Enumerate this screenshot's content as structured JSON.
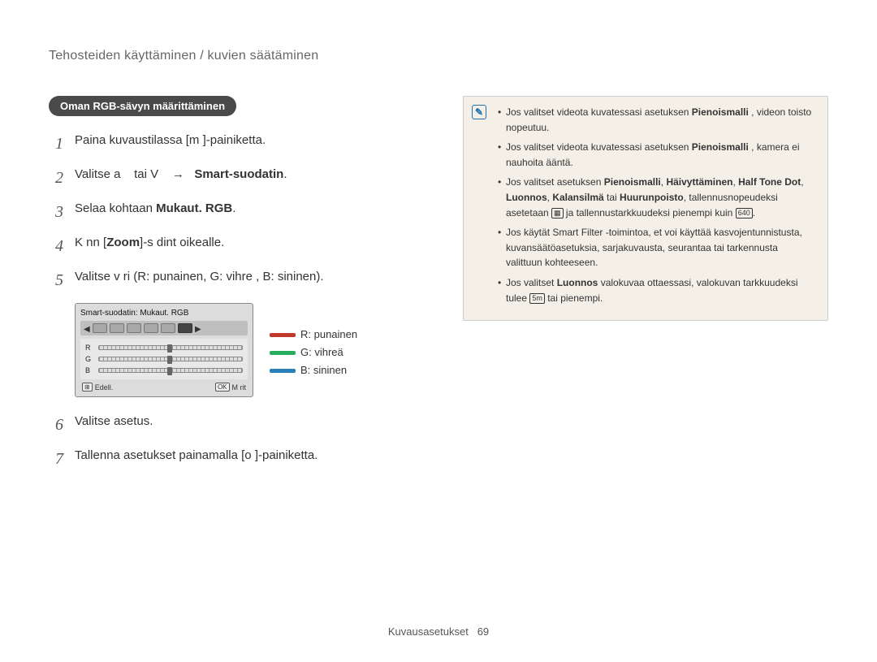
{
  "header": "Tehosteiden käyttäminen / kuvien säätäminen",
  "pill": "Oman RGB-sävyn määrittäminen",
  "steps": {
    "s1_a": "Paina kuvaustilassa [m",
    "s1_b": "]-painiketta.",
    "s2_a": "Valitse a",
    "s2_b": "tai V",
    "s2_arrow": "→",
    "s2_bold": "Smart-suodatin",
    "s2_dot": ".",
    "s3_a": "Selaa kohtaan ",
    "s3_bold": "Mukaut. RGB",
    "s3_dot": ".",
    "s4_a": "K  nn  [",
    "s4_bold": "Zoom",
    "s4_b": "]-s  dint  oikealle.",
    "s5": "Valitse v ri (R: punainen, G: vihre , B: sininen).",
    "s6": "Valitse asetus.",
    "s7_a": "Tallenna asetukset painamalla [o",
    "s7_b": "]-painiketta."
  },
  "device": {
    "title": "Smart-suodatin: Mukaut. RGB",
    "rgb": [
      "R",
      "G",
      "B"
    ],
    "back_chip": "⊞",
    "back": "Edell.",
    "ok_chip": "OK",
    "ok": "M  rit"
  },
  "legend": {
    "r": "R: punainen",
    "g": "G: vihreä",
    "b": "B: sininen"
  },
  "note": {
    "n1_a": "Jos valitset videota kuvatessasi asetuksen ",
    "n1_b": "Pienoismalli",
    "n1_c": " , videon toisto nopeutuu.",
    "n2_a": "Jos valitset videota kuvatessasi asetuksen ",
    "n2_b": "Pienoismalli",
    "n2_c": " , kamera ei nauhoita ääntä.",
    "n3_a": "Jos valitset asetuksen ",
    "n3_b": "Pienoismalli",
    "n3_c": ", ",
    "n3_d": "Häivyttäminen",
    "n3_e": ", ",
    "n3_f": "Half Tone Dot",
    "n3_g": ", ",
    "n3_h": "Luonnos",
    "n3_i": ", ",
    "n3_j": "Kalansilmä",
    "n3_k": " tai ",
    "n3_l": "Huurunpoisto",
    "n3_m": ", tallennusnopeudeksi asetetaan ",
    "n3_n": " ja tallennustarkkuudeksi pienempi kuin ",
    "n3_o": ".",
    "n4": "Jos käytät Smart Filter -toimintoa, et voi käyttää kasvojentunnistusta, kuvansäätöasetuksia, sarjakuvausta, seurantaa tai tarkennusta valittuun kohteeseen.",
    "n5_a": "Jos valitset ",
    "n5_b": "Luonnos",
    "n5_c": " valokuvaa ottaessasi, valokuvan tarkkuudeksi tulee ",
    "n5_d": " tai pienempi.",
    "icon1": "▦",
    "icon2": "640",
    "icon3": "5m"
  },
  "footer": {
    "section": "Kuvausasetukset",
    "page": "69"
  }
}
